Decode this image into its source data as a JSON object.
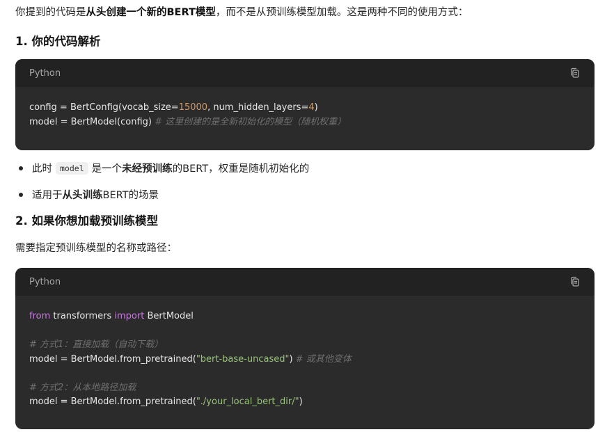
{
  "intro": {
    "part1": "你提到的代码是",
    "bold1": "从头创建一个新的BERT模型",
    "part2": "，而不是从预训练模型加载。这是两种不同的使用方式："
  },
  "section1": {
    "title": "1. 你的代码解析"
  },
  "code_block_1": {
    "language": "Python",
    "copy_icon": "copy-icon",
    "line1": {
      "a": "config = BertConfig(vocab_size=",
      "n1": "15000",
      "b": ", num_hidden_layers=",
      "n2": "4",
      "c": ")"
    },
    "line2": {
      "a": "model = BertModel(config) ",
      "comment": "# 这里创建的是全新初始化的模型（随机权重）"
    }
  },
  "bullets": [
    {
      "pre": "此时",
      "code": "model",
      "mid": "是一个",
      "bold": "未经预训练",
      "post": "的BERT，权重是随机初始化的"
    },
    {
      "pre": "适用于",
      "bold": "从头训练",
      "post": "BERT的场景"
    }
  ],
  "section2": {
    "title": "2. 如果你想加载预训练模型",
    "desc": "需要指定预训练模型的名称或路径："
  },
  "code_block_2": {
    "language": "Python",
    "copy_icon": "copy-icon",
    "line1": {
      "kw1": "from",
      "a": " transformers ",
      "kw2": "import",
      "b": " BertModel"
    },
    "comment1": "# 方式1：直接加载（自动下载）",
    "line3": {
      "a": "model = BertModel.from_pretrained(",
      "str": "\"bert-base-uncased\"",
      "b": ") ",
      "comment": "# 或其他变体"
    },
    "comment2": "# 方式2：从本地路径加载",
    "line5": {
      "a": "model = BertModel.from_pretrained(",
      "str": "\"./your_local_bert_dir/\"",
      "b": ")"
    }
  }
}
